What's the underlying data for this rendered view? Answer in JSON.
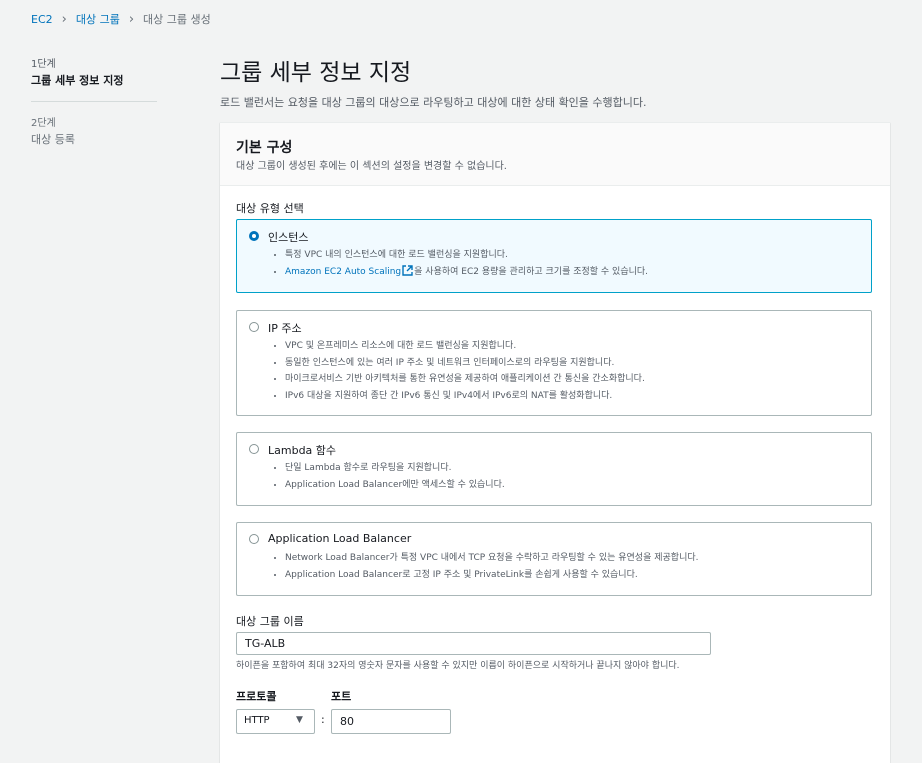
{
  "breadcrumb": {
    "root": "EC2",
    "parent": "대상 그룹",
    "current": "대상 그룹 생성"
  },
  "steps": [
    {
      "num": "1단계",
      "label": "그룹 세부 정보 지정"
    },
    {
      "num": "2단계",
      "label": "대상 등록"
    }
  ],
  "page": {
    "title": "그룹 세부 정보 지정",
    "description": "로드 밸런서는 요청을 대상 그룹의 대상으로 라우팅하고 대상에 대한 상태 확인을 수행합니다."
  },
  "panel": {
    "title": "기본 구성",
    "subtitle": "대상 그룹이 생성된 후에는 이 섹션의 설정을 변경할 수 없습니다."
  },
  "target_type": {
    "label": "대상 유형 선택",
    "selected": "인스턴스",
    "options": [
      {
        "title": "인스턴스",
        "bullets": [
          "특정 VPC 내의 인스턴스에 대한 로드 밸런싱을 지원합니다.",
          "을 사용하여 EC2 용량을 관리하고 크기를 조정할 수 있습니다."
        ],
        "link": "Amazon EC2 Auto Scaling"
      },
      {
        "title": "IP 주소",
        "bullets": [
          "VPC 및 온프레미스 리소스에 대한 로드 밸런싱을 지원합니다.",
          "동일한 인스턴스에 있는 여러 IP 주소 및 네트워크 인터페이스로의 라우팅을 지원합니다.",
          "마이크로서비스 기반 아키텍처를 통한 유연성을 제공하여 애플리케이션 간 통신을 간소화합니다.",
          "IPv6 대상을 지원하여 종단 간 IPv6 통신 및 IPv4에서 IPv6로의 NAT를 활성화합니다."
        ]
      },
      {
        "title": "Lambda 함수",
        "bullets": [
          "단일 Lambda 함수로 라우팅을 지원합니다.",
          "Application Load Balancer에만 액세스할 수 있습니다."
        ]
      },
      {
        "title": "Application Load Balancer",
        "bullets": [
          "Network Load Balancer가 특정 VPC 내에서 TCP 요청을 수락하고 라우팅할 수 있는 유연성을 제공합니다.",
          "Application Load Balancer로 고정 IP 주소 및 PrivateLink를 손쉽게 사용할 수 있습니다."
        ]
      }
    ]
  },
  "group_name": {
    "label": "대상 그룹 이름",
    "value": "TG-ALB",
    "hint": "하이픈을 포함하여 최대 32자의 영숫자 문자를 사용할 수 있지만 이름이 하이픈으로 시작하거나 끝나지 않아야 합니다."
  },
  "protocol": {
    "label": "프로토콜",
    "value": "HTTP"
  },
  "port": {
    "label": "포트",
    "value": "80",
    "separator": ":"
  },
  "colors": {
    "link": "#0073bb",
    "selected_border": "#00a1c9",
    "selected_bg": "#f1faff"
  }
}
